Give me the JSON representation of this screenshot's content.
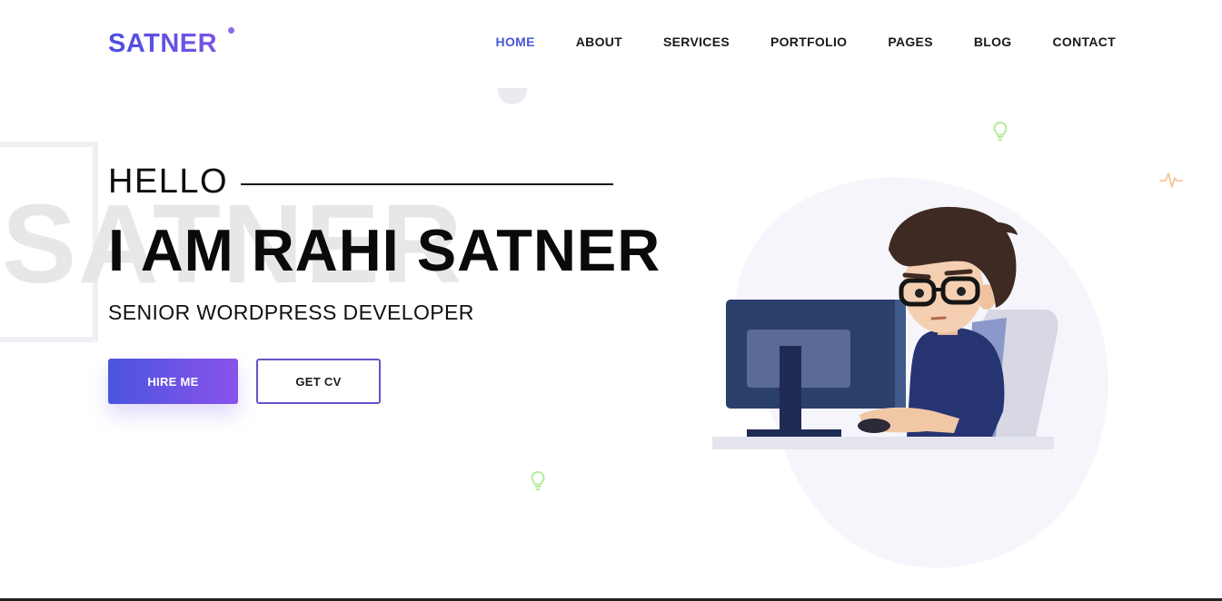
{
  "brand": {
    "name": "SATNER",
    "accent": "#4a58d6",
    "gradient_start": "#4a55df",
    "gradient_end": "#8a52ea"
  },
  "nav": {
    "items": [
      {
        "label": "HOME",
        "active": true
      },
      {
        "label": "ABOUT",
        "active": false
      },
      {
        "label": "SERVICES",
        "active": false
      },
      {
        "label": "PORTFOLIO",
        "active": false
      },
      {
        "label": "PAGES",
        "active": false
      },
      {
        "label": "BLOG",
        "active": false
      },
      {
        "label": "CONTACT",
        "active": false
      }
    ]
  },
  "hero": {
    "background_word": "SATNER",
    "greeting": "HELLO",
    "headline": "I AM RAHI SATNER",
    "subtitle": "SENIOR WORDPRESS DEVELOPER",
    "primary_button": "HIRE ME",
    "secondary_button": "GET CV"
  },
  "icons": {
    "bulbs": [
      "lightbulb-icon",
      "lightbulb-icon"
    ],
    "pulse": "heartbeat-icon",
    "illustration": "developer-at-computer-illustration"
  }
}
